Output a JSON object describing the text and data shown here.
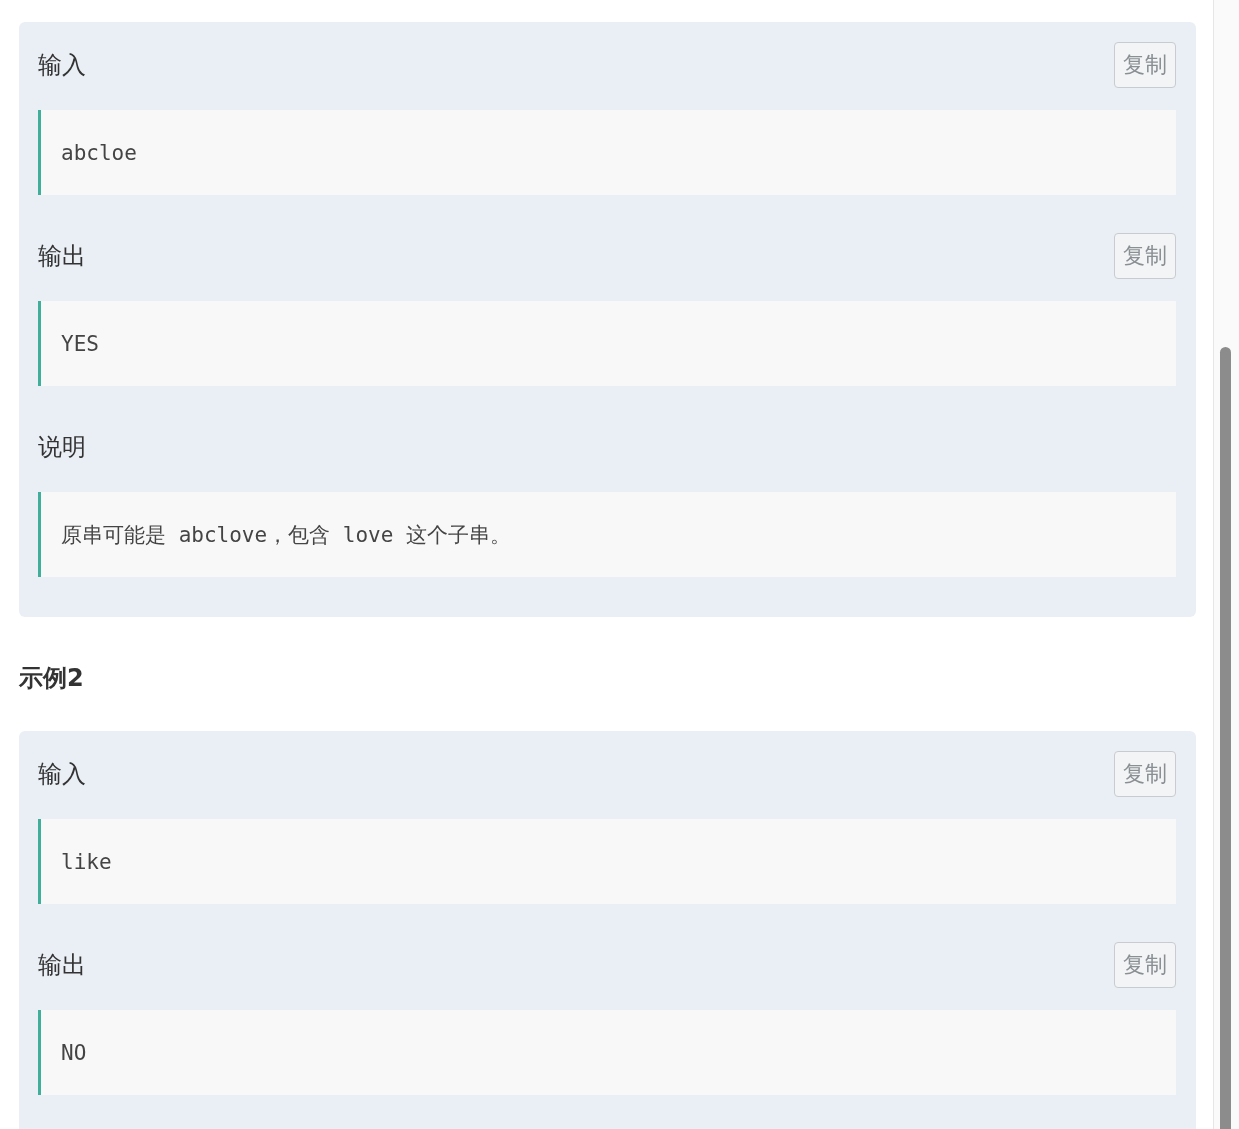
{
  "examples": [
    {
      "sections": [
        {
          "label": "输入",
          "copy_button": "复制",
          "content": "abcloe"
        },
        {
          "label": "输出",
          "copy_button": "复制",
          "content": "YES"
        },
        {
          "label": "说明",
          "content": "原串可能是 abclove，包含 love 这个子串。"
        }
      ]
    },
    {
      "title": "示例2",
      "sections": [
        {
          "label": "输入",
          "copy_button": "复制",
          "content": "like"
        },
        {
          "label": "输出",
          "copy_button": "复制",
          "content": "NO"
        }
      ]
    }
  ]
}
